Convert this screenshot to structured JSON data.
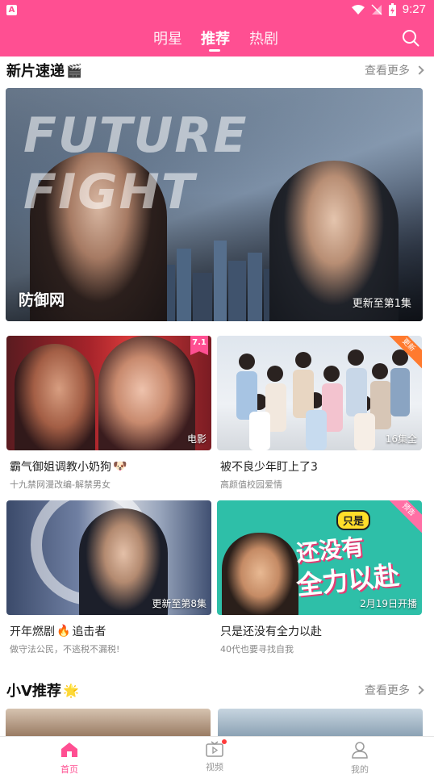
{
  "status_bar": {
    "time": "9:27",
    "app_badge": "A"
  },
  "header": {
    "tabs": [
      {
        "label": "明星",
        "active": false
      },
      {
        "label": "推荐",
        "active": true
      },
      {
        "label": "热剧",
        "active": false
      }
    ],
    "search_icon": "search-icon",
    "accent_color": "#ff4f92"
  },
  "section_new": {
    "title": "新片速递",
    "title_icon": "🎬",
    "more_label": "查看更多"
  },
  "hero": {
    "logo_text": "FUTURE FIGHT",
    "title": "防御网",
    "badge": "更新至第1集"
  },
  "cards": [
    {
      "title": "霸气御姐调教小奶狗",
      "emoji": "🐶",
      "subtitle": "十九禁网漫改编-解禁男女",
      "tag": "电影",
      "rating": "7.1"
    },
    {
      "title": "被不良少年盯上了3",
      "emoji": "",
      "subtitle": "高颜值校园爱情",
      "tag": "16集全",
      "corner": "更新"
    },
    {
      "title": "开年燃剧",
      "emoji": "🔥",
      "title_suffix": "追击者",
      "subtitle": "做守法公民，不逃税不漏税!",
      "tag": "更新至第8集"
    },
    {
      "title": "只是还没有全力以赴",
      "emoji": "",
      "subtitle": "40代也要寻找自我",
      "tag": "2月19日开播",
      "corner": "预告",
      "poster_bubble": "只是",
      "poster_line1": "还没有",
      "poster_line2": "全力以赴"
    }
  ],
  "section_v": {
    "title": "小V推荐",
    "title_icon": "🌟",
    "more_label": "查看更多"
  },
  "bottom_nav": [
    {
      "label": "首页",
      "icon": "home-icon",
      "active": true
    },
    {
      "label": "视频",
      "icon": "tv-icon",
      "active": false
    },
    {
      "label": "我的",
      "icon": "user-icon",
      "active": false
    }
  ]
}
